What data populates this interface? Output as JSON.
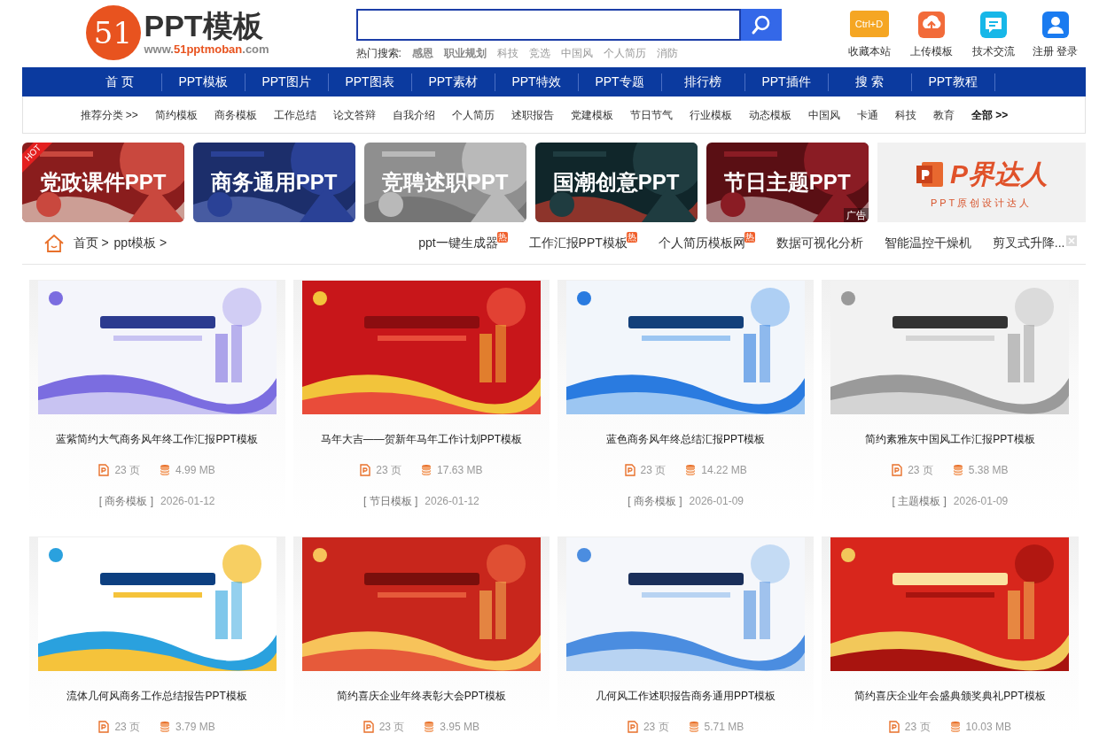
{
  "logo": {
    "mark": "51",
    "name": "PPT模板",
    "url_prefix": "www.",
    "url_brand": "51pptmoban",
    "url_suffix": ".com"
  },
  "search": {
    "hot_label": "热门搜索:",
    "hot_terms": [
      {
        "text": "感恩",
        "bold": true
      },
      {
        "text": "职业规划",
        "bold": true
      },
      {
        "text": "科技",
        "bold": false
      },
      {
        "text": "竞选",
        "bold": false
      },
      {
        "text": "中国风",
        "bold": false
      },
      {
        "text": "个人简历",
        "bold": false
      },
      {
        "text": "消防",
        "bold": false
      }
    ]
  },
  "quick_links": [
    {
      "kind": "bookmark",
      "label": "收藏本站",
      "badge": "Ctrl+D"
    },
    {
      "kind": "upload",
      "label": "上传模板"
    },
    {
      "kind": "chat",
      "label": "技术交流"
    },
    {
      "kind": "user",
      "label": "注册 登录"
    }
  ],
  "nav": [
    "首 页",
    "PPT模板",
    "PPT图片",
    "PPT图表",
    "PPT素材",
    "PPT特效",
    "PPT专题",
    "排行榜",
    "PPT插件",
    "搜 索",
    "PPT教程"
  ],
  "categories": {
    "label": "推荐分类 >>",
    "items": [
      "简约模板",
      "商务模板",
      "工作总结",
      "论文答辩",
      "自我介绍",
      "个人简历",
      "述职报告",
      "党建模板",
      "节日节气",
      "行业模板",
      "动态模板",
      "中国风",
      "卡通",
      "科技",
      "教育"
    ],
    "all": "全部 >>"
  },
  "banners": [
    {
      "kind": "banner",
      "title": "党政课件PPT",
      "hot_label": "HOT"
    },
    {
      "kind": "banner",
      "title": "商务通用PPT"
    },
    {
      "kind": "banner",
      "title": "竞聘述职PPT"
    },
    {
      "kind": "banner",
      "title": "国潮创意PPT"
    },
    {
      "kind": "banner",
      "title": "节日主题PPT",
      "ad_label": "广告"
    },
    {
      "kind": "ad",
      "title": "P界达人",
      "subtitle": "PPT原创设计达人"
    }
  ],
  "breadcrumb": [
    "首页 >",
    "ppt模板 >"
  ],
  "promo_links": [
    {
      "text": "ppt一键生成器",
      "hot_label": "热"
    },
    {
      "text": "工作汇报PPT模板",
      "hot_label": "热"
    },
    {
      "text": "个人简历模板网",
      "hot_label": "热"
    },
    {
      "text": "数据可视化分析"
    },
    {
      "text": "智能温控干燥机"
    },
    {
      "text": "剪叉式升降...",
      "closable": true
    }
  ],
  "cards": [
    {
      "title": "蓝紫简约大气商务风年终工作汇报PPT模板",
      "pages": "23 页",
      "size": "4.99 MB",
      "category": "[ 商务模板 ]",
      "date": "2026-01-12"
    },
    {
      "title": "马年大吉——贺新年马年工作计划PPT模板",
      "pages": "23 页",
      "size": "17.63 MB",
      "category": "[ 节日模板 ]",
      "date": "2026-01-12"
    },
    {
      "title": "蓝色商务风年终总结汇报PPT模板",
      "pages": "23 页",
      "size": "14.22 MB",
      "category": "[ 商务模板 ]",
      "date": "2026-01-09"
    },
    {
      "title": "简约素雅灰中国风工作汇报PPT模板",
      "pages": "23 页",
      "size": "5.38 MB",
      "category": "[ 主题模板 ]",
      "date": "2026-01-09"
    },
    {
      "title": "流体几何风商务工作总结报告PPT模板",
      "pages": "23 页",
      "size": "3.79 MB"
    },
    {
      "title": "简约喜庆企业年终表彰大会PPT模板",
      "pages": "23 页",
      "size": "3.95 MB"
    },
    {
      "title": "几何风工作述职报告商务通用PPT模板",
      "pages": "23 页",
      "size": "5.71 MB"
    },
    {
      "title": "简约喜庆企业年会盛典颁奖典礼PPT模板",
      "pages": "23 页",
      "size": "10.03 MB"
    }
  ]
}
